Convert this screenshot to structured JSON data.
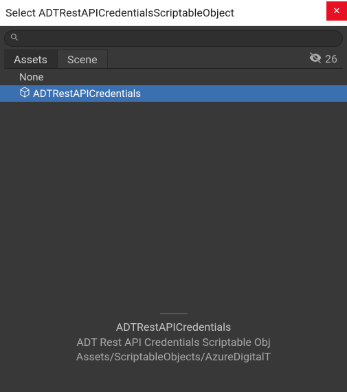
{
  "window": {
    "title": "Select ADTRestAPICredentialsScriptableObject"
  },
  "search": {
    "value": "",
    "placeholder": ""
  },
  "tabs": [
    {
      "label": "Assets",
      "active": true
    },
    {
      "label": "Scene",
      "active": false
    }
  ],
  "hidden_count": "26",
  "list": {
    "items": [
      {
        "label": "None",
        "icon": null,
        "selected": false
      },
      {
        "label": "ADTRestAPICredentials",
        "icon": "scriptable-object-icon",
        "selected": true
      }
    ]
  },
  "details": {
    "name": "ADTRestAPICredentials",
    "type": "ADT Rest API Credentials Scriptable Obj",
    "path": "Assets/ScriptableObjects/AzureDigitalT"
  },
  "colors": {
    "selection": "#3a6fb0",
    "panel_bg": "#383838",
    "close_btn": "#e81123"
  }
}
